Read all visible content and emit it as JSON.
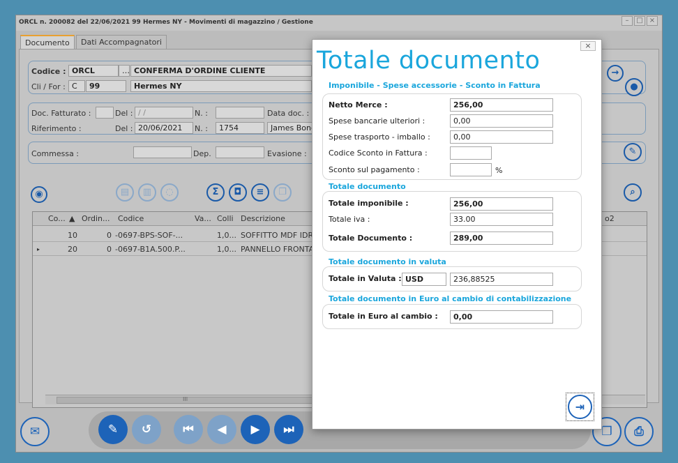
{
  "main_window": {
    "title": "ORCL n. 200082 del 22/06/2021 99 Hermes NY - Movimenti di magazzino / Gestione",
    "tabs": [
      "Documento",
      "Dati Accompagnatori"
    ],
    "header": {
      "codice_label": "Codice :",
      "codice_value": "ORCL",
      "doc_type": "CONFERMA D'ORDINE CLIENTE",
      "cli_for_label": "Cli / For :",
      "cli_for_type": "C",
      "cli_for_code": "99",
      "cli_for_name": "Hermes NY"
    },
    "doc_fatturato_label": "Doc. Fatturato :",
    "del_label": "Del :",
    "del_value_1": "/ /",
    "n_label": "N. :",
    "data_doc_label": "Data doc. :",
    "riferimento_label": "Riferimento :",
    "del_value_2": "20/06/2021",
    "n_value_2": "1754",
    "riferimento_name": "James Bond",
    "commessa_label": "Commessa :",
    "dep_label": "Dep.",
    "evasione_label": "Evasione :",
    "grid": {
      "headers": [
        "Co...",
        "Ordin...",
        "Codice",
        "Va...",
        "Colli",
        "Descrizione",
        "o2"
      ],
      "rows": [
        {
          "co": "10",
          "ord": "0",
          "codice": "-0697-BPS-SOF-...",
          "colli": "1,0...",
          "descr": "SOFFITTO MDF IDRO"
        },
        {
          "co": "20",
          "ord": "0",
          "codice": "-0697-B1A.500.P...",
          "colli": "1,0...",
          "descr": "PANNELLO FRONTAL"
        }
      ],
      "scroll_glyph": "III"
    }
  },
  "dialog": {
    "title": "Totale documento",
    "close_label": "×",
    "sections": {
      "imponibile": "Imponibile - Spese accessorie - Sconto in Fattura",
      "totale": "Totale documento",
      "valuta": "Totale documento in valuta",
      "euro": "Totale documento in Euro al cambio di contabilizzazione"
    },
    "netto_merce_label": "Netto Merce :",
    "netto_merce_value": "256,00",
    "spese_bancarie_label": "Spese bancarie ulteriori :",
    "spese_bancarie_value": "0,00",
    "spese_trasporto_label": "Spese trasporto - imballo :",
    "spese_trasporto_value": "0,00",
    "codice_sconto_label": "Codice Sconto in Fattura :",
    "codice_sconto_value": "",
    "sconto_pagamento_label": "Sconto sul pagamento :",
    "sconto_pagamento_value": "",
    "percent_label": "%",
    "totale_imponibile_label": "Totale imponibile :",
    "totale_imponibile_value": "256,00",
    "totale_iva_label": "Totale iva :",
    "totale_iva_value": "33.00",
    "totale_documento_label": "Totale Documento :",
    "totale_documento_value": "289,00",
    "totale_valuta_label": "Totale in Valuta :",
    "valuta_code": "USD",
    "valuta_value": "236,88525",
    "totale_euro_label": "Totale in Euro al cambio :",
    "totale_euro_value": "0,00"
  },
  "icons": {
    "exit": "exit-door-icon",
    "navigate": "arrow-right-icon",
    "user": "user-icon",
    "eye": "eye-icon",
    "sum": "sigma-icon",
    "camera": "camera-icon",
    "mail": "mail-icon",
    "print": "printer-icon"
  },
  "colors": {
    "accent": "#1aa6dc",
    "button_blue": "#1d63b8",
    "background": "#4d8fb0"
  }
}
